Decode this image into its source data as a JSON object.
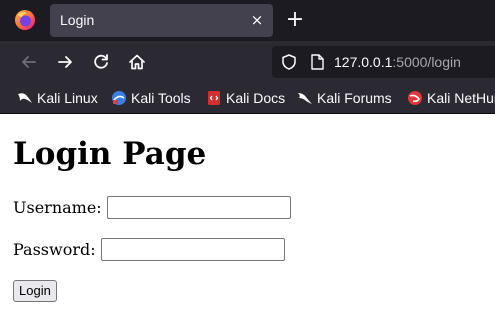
{
  "browser": {
    "tab": {
      "title": "Login",
      "close_glyph": "×"
    },
    "new_tab_glyph": "+",
    "url": {
      "host": "127.0.0.1",
      "rest": ":5000/login"
    },
    "icons": {
      "app": "firefox-icon",
      "back": "back-arrow-icon",
      "forward": "forward-arrow-icon",
      "reload": "reload-icon",
      "home": "home-icon",
      "security": "shield-icon",
      "page": "page-icon"
    },
    "bookmarks": [
      {
        "label": "Kali Linux",
        "icon": "kali-dragon-icon"
      },
      {
        "label": "Kali Tools",
        "icon": "kali-tools-icon"
      },
      {
        "label": "Kali Docs",
        "icon": "kali-docs-icon"
      },
      {
        "label": "Kali Forums",
        "icon": "kali-forums-icon"
      },
      {
        "label": "Kali NetHunter",
        "icon": "kali-nethunter-icon"
      }
    ],
    "colors": {
      "tabbar": "#1c1b22",
      "toolbar": "#2b2a33",
      "active_tab": "#42414d",
      "text": "#fbfbfe"
    }
  },
  "page": {
    "title": "Login Page",
    "username": {
      "label": "Username:",
      "value": "",
      "placeholder": ""
    },
    "password": {
      "label": "Password:",
      "value": "",
      "placeholder": ""
    },
    "submit_label": "Login"
  }
}
